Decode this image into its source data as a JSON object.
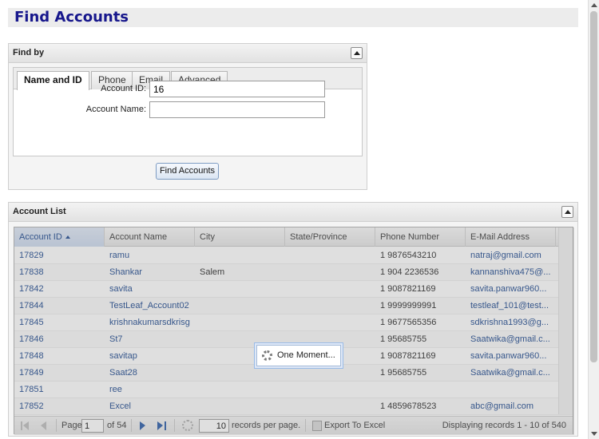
{
  "page": {
    "title": "Find Accounts"
  },
  "find_by": {
    "header": "Find by",
    "tabs": [
      {
        "label": "Name and ID",
        "active": true
      },
      {
        "label": "Phone",
        "active": false
      },
      {
        "label": "Email",
        "active": false
      },
      {
        "label": "Advanced",
        "active": false
      }
    ],
    "fields": {
      "account_id": {
        "label": "Account ID:",
        "value": "16"
      },
      "account_name": {
        "label": "Account Name:",
        "value": ""
      }
    },
    "submit_label": "Find Accounts"
  },
  "account_list": {
    "header": "Account List",
    "columns": [
      "Account ID",
      "Account Name",
      "City",
      "State/Province",
      "Phone Number",
      "E-Mail Address"
    ],
    "sorted_column": "Account ID",
    "rows": [
      {
        "id": "17829",
        "name": "ramu",
        "city": "",
        "state": "",
        "phone": "1 9876543210",
        "email": "natraj@gmail.com"
      },
      {
        "id": "17838",
        "name": "Shankar",
        "city": "Salem",
        "state": "",
        "phone": "1 904 2236536",
        "email": "kannanshiva475@..."
      },
      {
        "id": "17842",
        "name": "savita",
        "city": "",
        "state": "",
        "phone": "1 9087821169",
        "email": "savita.panwar960..."
      },
      {
        "id": "17844",
        "name": "TestLeaf_Account02",
        "city": "",
        "state": "",
        "phone": "1 9999999991",
        "email": "testleaf_101@test..."
      },
      {
        "id": "17845",
        "name": "krishnakumarsdkrisg",
        "city": "",
        "state": "",
        "phone": "1 9677565356",
        "email": "sdkrishna1993@g..."
      },
      {
        "id": "17846",
        "name": "St7",
        "city": "",
        "state": "",
        "phone": "1 95685755",
        "email": "Saatwika@gmail.c..."
      },
      {
        "id": "17848",
        "name": "savitap",
        "city": "",
        "state": "",
        "phone": "1 9087821169",
        "email": "savita.panwar960..."
      },
      {
        "id": "17849",
        "name": "Saat28",
        "city": "",
        "state": "",
        "phone": "1 95685755",
        "email": "Saatwika@gmail.c..."
      },
      {
        "id": "17851",
        "name": "ree",
        "city": "",
        "state": "",
        "phone": "",
        "email": ""
      },
      {
        "id": "17852",
        "name": "Excel",
        "city": "",
        "state": "",
        "phone": "1 4859678523",
        "email": "abc@gmail.com"
      }
    ],
    "pager": {
      "page_label": "Page",
      "page_value": "1",
      "of_label": "of 54",
      "per_page_value": "10",
      "per_page_label": "records per page.",
      "export_label": "Export To Excel",
      "display_text": "Displaying records 1 - 10 of 540"
    },
    "loading_text": "One Moment..."
  },
  "colors": {
    "title": "#17178c",
    "link": "#15428b",
    "mask": "#8c8c8c"
  }
}
